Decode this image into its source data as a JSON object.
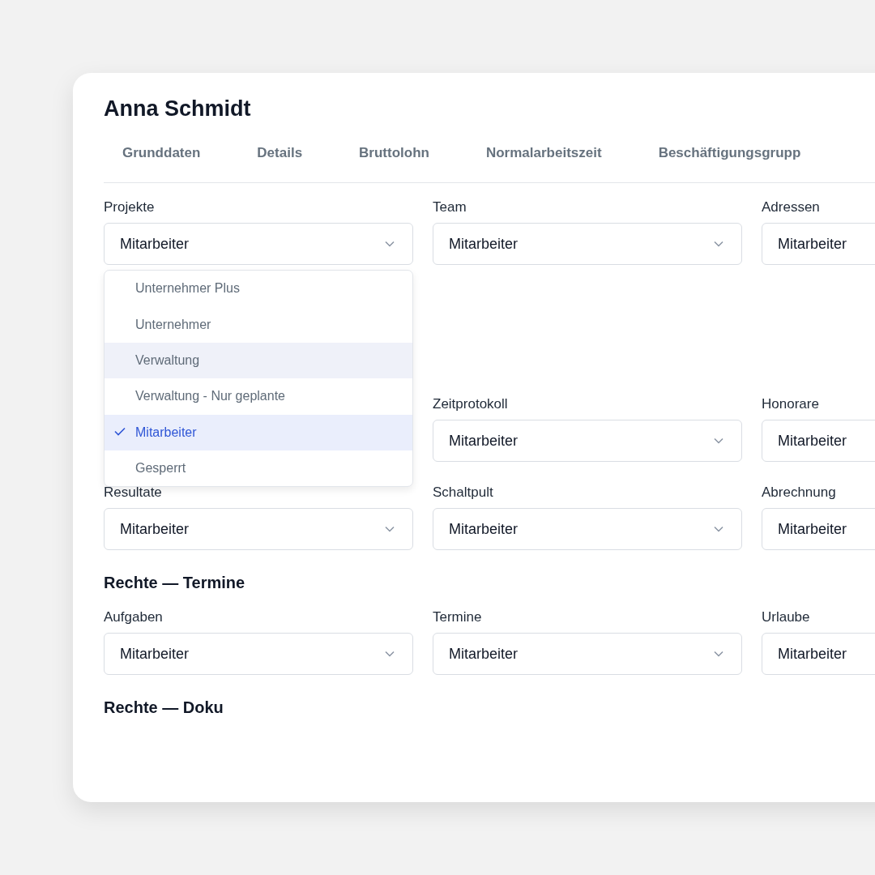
{
  "title": "Anna Schmidt",
  "tabs": [
    {
      "label": "Grunddaten"
    },
    {
      "label": "Details"
    },
    {
      "label": "Bruttolohn"
    },
    {
      "label": "Normalarbeitszeit"
    },
    {
      "label": "Beschäftigungsgrupp"
    }
  ],
  "sections": [
    {
      "rows": [
        [
          {
            "label": "Projekte",
            "value": "Mitarbeiter",
            "open": true,
            "options": [
              {
                "label": "Unternehmer Plus",
                "selected": false,
                "hovered": false
              },
              {
                "label": "Unternehmer",
                "selected": false,
                "hovered": false
              },
              {
                "label": "Verwaltung",
                "selected": false,
                "hovered": true
              },
              {
                "label": "Verwaltung - Nur geplante",
                "selected": false,
                "hovered": false
              },
              {
                "label": "Mitarbeiter",
                "selected": true,
                "hovered": false
              },
              {
                "label": "Gesperrt",
                "selected": false,
                "hovered": false
              }
            ]
          },
          {
            "label": "Team",
            "value": "Mitarbeiter"
          },
          {
            "label": "Adressen",
            "value": "Mitarbeiter"
          }
        ],
        [
          null,
          {
            "label": "Zeitprotokoll",
            "value": "Mitarbeiter"
          },
          {
            "label": "Honorare",
            "value": "Mitarbeiter"
          }
        ],
        [
          {
            "label": "Resultate",
            "value": "Mitarbeiter"
          },
          {
            "label": "Schaltpult",
            "value": "Mitarbeiter"
          },
          {
            "label": "Abrechnung",
            "value": "Mitarbeiter"
          }
        ]
      ]
    },
    {
      "heading": "Rechte — Termine",
      "rows": [
        [
          {
            "label": "Aufgaben",
            "value": "Mitarbeiter"
          },
          {
            "label": "Termine",
            "value": "Mitarbeiter"
          },
          {
            "label": "Urlaube",
            "value": "Mitarbeiter"
          }
        ]
      ]
    },
    {
      "heading": "Rechte — Doku"
    }
  ]
}
